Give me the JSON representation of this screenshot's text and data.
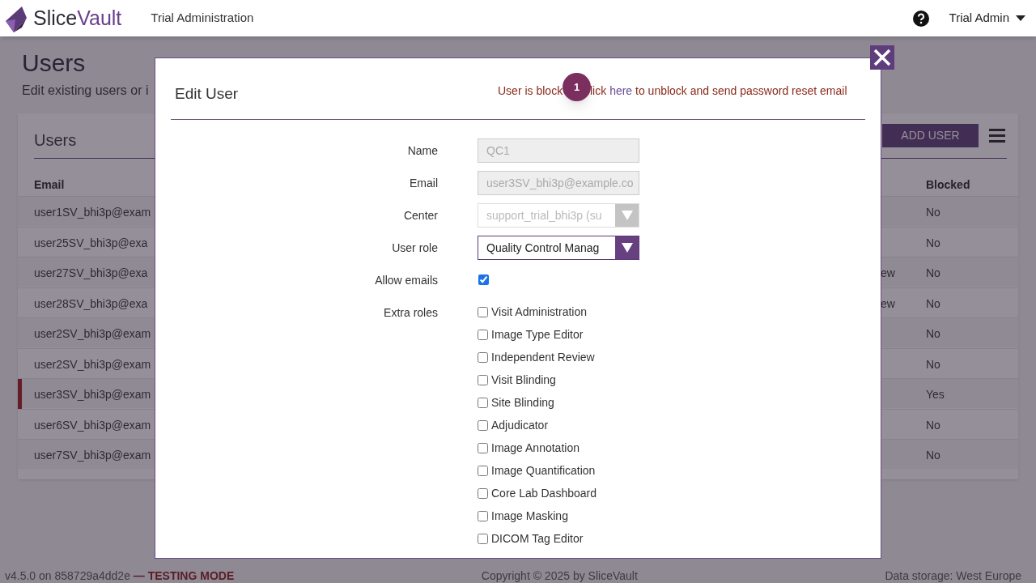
{
  "header": {
    "logo_start": "Slice",
    "logo_end": "Vault",
    "nav": "Trial Administration",
    "user": "Trial Admin"
  },
  "page": {
    "title": "Users",
    "subtitle": "Edit existing users or i",
    "card_title": "Users",
    "add_button": "ADD USER",
    "columns": [
      "Email",
      "Blocked"
    ],
    "rows": [
      {
        "email": "user1SV_bhi3p@exam",
        "column_3": "",
        "blocked": "No",
        "selected": false
      },
      {
        "email": "user25SV_bhi3p@exa",
        "column_3": "",
        "blocked": "No",
        "selected": false
      },
      {
        "email": "user27SV_bhi3p@exa",
        "column_3": "ew",
        "blocked": "No",
        "selected": false
      },
      {
        "email": "user28SV_bhi3p@exa",
        "column_3": "ew",
        "blocked": "No",
        "selected": false
      },
      {
        "email": "user2SV_bhi3p@exam",
        "column_3": "",
        "blocked": "No",
        "selected": false
      },
      {
        "email": "user2SV_bhi3p@exam",
        "column_3": "",
        "blocked": "No",
        "selected": false
      },
      {
        "email": "user3SV_bhi3p@exam",
        "column_3": "",
        "blocked": "Yes",
        "selected": true
      },
      {
        "email": "user6SV_bhi3p@exam",
        "column_3": "",
        "blocked": "No",
        "selected": false
      },
      {
        "email": "user7SV_bhi3p@exam",
        "column_3": "",
        "blocked": "No",
        "selected": false
      }
    ]
  },
  "footer": {
    "version": "v4.5.0 on 858729a4dd2e",
    "mode": "— TESTING MODE",
    "copyright": "Copyright © 2025 by SliceVault",
    "storage": "Data storage: West Europe"
  },
  "modal": {
    "title": "Edit User",
    "notice_start": "User is block",
    "notice_middle": "lick",
    "notice_link": "here",
    "notice_end": "to unblock and send password reset email",
    "badge": "1",
    "fields": [
      {
        "kind": "text",
        "label": "Name",
        "value": "QC1",
        "disabled": true
      },
      {
        "kind": "text",
        "label": "Email",
        "value": "user3SV_bhi3p@example.co",
        "disabled": true
      },
      {
        "kind": "select",
        "label": "Center",
        "value": "support_trial_bhi3p (su",
        "disabled": true
      },
      {
        "kind": "select",
        "label": "User role",
        "value": "Quality Control Manag",
        "disabled": false
      },
      {
        "kind": "checkbox",
        "label": "Allow emails",
        "checked": true
      }
    ],
    "extra_roles": {
      "label": "Extra roles",
      "items": [
        {
          "label": "Visit Administration",
          "checked": false
        },
        {
          "label": "Image Type Editor",
          "checked": false
        },
        {
          "label": "Independent Review",
          "checked": false
        },
        {
          "label": "Visit Blinding",
          "checked": false
        },
        {
          "label": "Site Blinding",
          "checked": false
        },
        {
          "label": "Adjudicator",
          "checked": false
        },
        {
          "label": "Image Annotation",
          "checked": false
        },
        {
          "label": "Image Quantification",
          "checked": false
        },
        {
          "label": "Core Lab Dashboard",
          "checked": false
        },
        {
          "label": "Image Masking",
          "checked": false
        },
        {
          "label": "DICOM Tag Editor",
          "checked": false
        }
      ]
    }
  }
}
